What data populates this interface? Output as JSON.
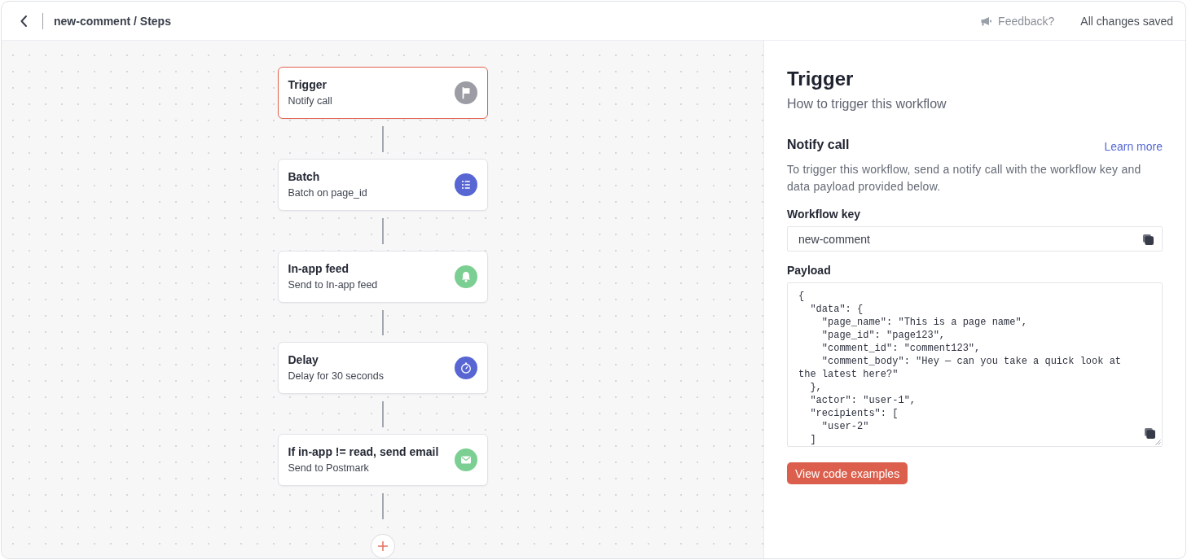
{
  "header": {
    "title": "new-comment / Steps",
    "feedback": "Feedback?",
    "save_status": "All changes saved"
  },
  "steps": [
    {
      "kind": "trigger",
      "title": "Trigger",
      "subtitle": "Notify call",
      "color": "#9b9ca4",
      "selected": true
    },
    {
      "kind": "batch",
      "title": "Batch",
      "subtitle": "Batch on page_id",
      "color": "#5866d3",
      "selected": false
    },
    {
      "kind": "in_app",
      "title": "In-app feed",
      "subtitle": "Send to In-app feed",
      "color": "#7ccf92",
      "selected": false
    },
    {
      "kind": "delay",
      "title": "Delay",
      "subtitle": "Delay for 30 seconds",
      "color": "#5866d3",
      "selected": false
    },
    {
      "kind": "email",
      "title": "If in-app != read, send email",
      "subtitle": "Send to Postmark",
      "color": "#7ccf92",
      "selected": false
    }
  ],
  "panel": {
    "title": "Trigger",
    "subtitle": "How to trigger this workflow",
    "section": {
      "title": "Notify call",
      "link": "Learn more",
      "description": "To trigger this workflow, send a notify call with the workflow key and data payload provided below."
    },
    "workflow_key": {
      "label": "Workflow key",
      "value": "new-comment"
    },
    "payload": {
      "label": "Payload",
      "value": "{\n  \"data\": {\n    \"page_name\": \"This is a page name\",\n    \"page_id\": \"page123\",\n    \"comment_id\": \"comment123\",\n    \"comment_body\": \"Hey — can you take a quick look at the latest here?\"\n  },\n  \"actor\": \"user-1\",\n  \"recipients\": [\n    \"user-2\"\n  ]"
    },
    "button": "View code examples"
  }
}
